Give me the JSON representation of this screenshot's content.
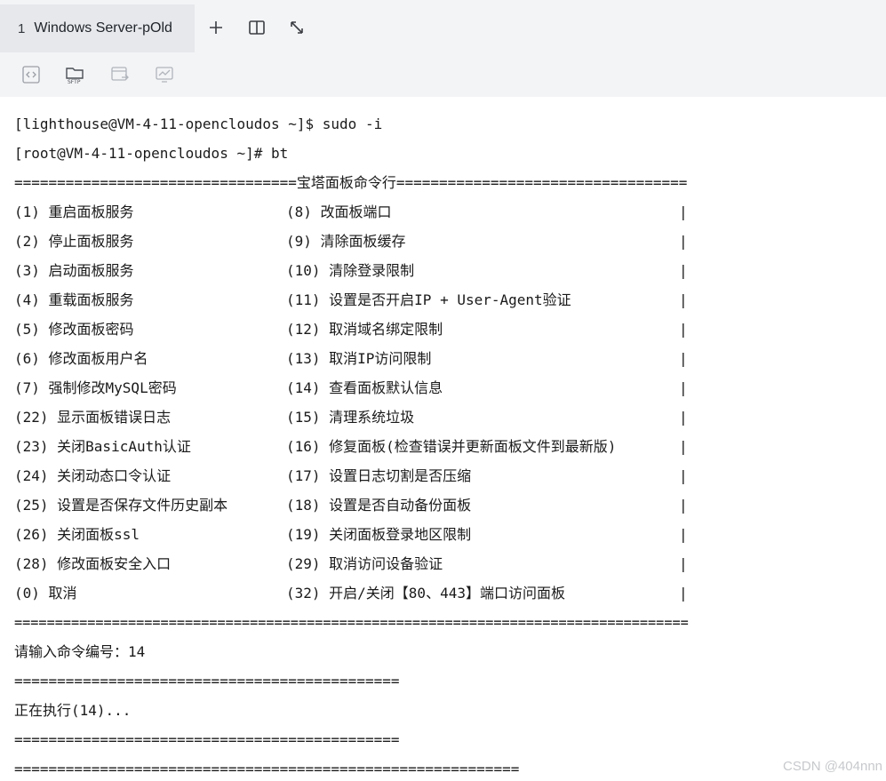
{
  "tab": {
    "number": "1",
    "title": "Windows Server-pOld"
  },
  "tab_actions": {
    "add_icon": "plus-icon",
    "split_icon": "split-view-icon",
    "expand_icon": "expand-icon"
  },
  "toolbar": {
    "items": [
      {
        "icon": "code-icon"
      },
      {
        "icon": "sftp-folder-icon",
        "label": "SFTP"
      },
      {
        "icon": "window-transfer-icon"
      },
      {
        "icon": "monitor-icon"
      }
    ]
  },
  "terminal": {
    "prompt1": "[lighthouse@VM-4-11-opencloudos ~]$ sudo -i",
    "prompt2": "[root@VM-4-11-opencloudos ~]# bt",
    "header": "=================================宝塔面板命令行==================================",
    "menu": [
      {
        "left": "(1) 重启面板服务",
        "right": "(8) 改面板端口"
      },
      {
        "left": "(2) 停止面板服务",
        "right": "(9) 清除面板缓存"
      },
      {
        "left": "(3) 启动面板服务",
        "right": "(10) 清除登录限制"
      },
      {
        "left": "(4) 重载面板服务",
        "right": "(11) 设置是否开启IP + User-Agent验证"
      },
      {
        "left": "(5) 修改面板密码",
        "right": "(12) 取消域名绑定限制"
      },
      {
        "left": "(6) 修改面板用户名",
        "right": "(13) 取消IP访问限制"
      },
      {
        "left": "(7) 强制修改MySQL密码",
        "right": "(14) 查看面板默认信息"
      },
      {
        "left": "(22) 显示面板错误日志",
        "right": "(15) 清理系统垃圾"
      },
      {
        "left": "(23) 关闭BasicAuth认证",
        "right": "(16) 修复面板(检查错误并更新面板文件到最新版)"
      },
      {
        "left": "(24) 关闭动态口令认证",
        "right": "(17) 设置日志切割是否压缩"
      },
      {
        "left": "(25) 设置是否保存文件历史副本",
        "right": "(18) 设置是否自动备份面板"
      },
      {
        "left": "(26) 关闭面板ssl",
        "right": "(19) 关闭面板登录地区限制"
      },
      {
        "left": "(28) 修改面板安全入口",
        "right": "(29) 取消访问设备验证"
      },
      {
        "left": "(0) 取消",
        "right": "(32) 开启/关闭【80、443】端口访问面板"
      }
    ],
    "bar_char": "|",
    "footer": "===================================================================================",
    "input_prompt": "请输入命令编号：14",
    "sep1": "=============================================",
    "executing": "正在执行(14)...",
    "sep2": "=============================================",
    "sep3": "==========================================================="
  },
  "watermark": "CSDN @404nnn"
}
